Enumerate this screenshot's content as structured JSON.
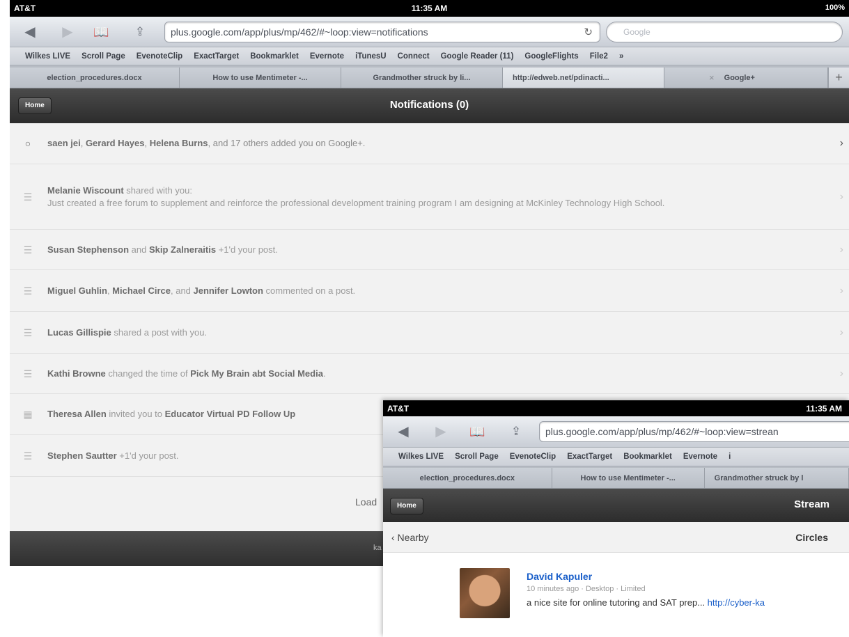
{
  "main": {
    "status": {
      "carrier": "AT&T",
      "time": "11:35 AM",
      "battery": "100%"
    },
    "url": "plus.google.com/app/plus/mp/462/#~loop:view=notifications",
    "search_placeholder": "Google",
    "bookmarks": [
      "Wilkes LIVE",
      "Scroll Page",
      "EvenoteClip",
      "ExactTarget",
      "Bookmarklet",
      "Evernote",
      "iTunesU",
      "Connect",
      "Google Reader (11)",
      "GoogleFlights",
      "File2",
      "»"
    ],
    "tabs": [
      {
        "label": "election_procedures.docx"
      },
      {
        "label": "How to use Mentimeter -..."
      },
      {
        "label": "Grandmother struck by li..."
      },
      {
        "label": "http://edweb.net/pdinacti..."
      },
      {
        "label": "Google+"
      }
    ],
    "tab_close": "×",
    "tab_plus": "+",
    "home_label": "Home",
    "title": "Notifications (0)",
    "notifications": [
      {
        "bold1": "saen jei",
        "t1": ", ",
        "bold2": "Gerard Hayes",
        "t2": ", ",
        "bold3": "Helena Burns",
        "t3": ", and 17 others added you on Google+."
      },
      {
        "bold1": "Melanie Wiscount",
        "t1": " shared with you:",
        "line2": "Just created a free forum to supplement and reinforce the professional development training program I am designing at McKinley Technology High School."
      },
      {
        "bold1": "Susan Stephenson",
        "t1": " and ",
        "bold2": "Skip Zalneraitis",
        "t2": " +1'd your post."
      },
      {
        "bold1": "Miguel Guhlin",
        "t1": ", ",
        "bold2": "Michael Circe",
        "t2": ", and ",
        "bold3": "Jennifer Lowton",
        "t3": " commented on a post."
      },
      {
        "bold1": "Lucas Gillispie",
        "t1": " shared a post with you."
      },
      {
        "bold1": "Kathi Browne",
        "t1": " changed the time of ",
        "bold2": "Pick My Brain abt Social Media",
        "t2": "."
      },
      {
        "bold1": "Theresa Allen",
        "t1": " invited you to ",
        "bold2": "Educator Virtual PD Follow Up",
        "t2": ""
      },
      {
        "bold1": "Stephen Sautter",
        "t1": " +1'd your post."
      }
    ],
    "load_text": "Load",
    "footer_text": "ka"
  },
  "overlay": {
    "status": {
      "carrier": "AT&T",
      "time": "11:35 AM"
    },
    "url": "plus.google.com/app/plus/mp/462/#~loop:view=strean",
    "bookmarks": [
      "Wilkes LIVE",
      "Scroll Page",
      "EvenoteClip",
      "ExactTarget",
      "Bookmarklet",
      "Evernote",
      "i"
    ],
    "tabs": [
      {
        "label": "election_procedures.docx"
      },
      {
        "label": "How to use Mentimeter -..."
      },
      {
        "label": "Grandmother struck by l"
      }
    ],
    "home_label": "Home",
    "title": "Stream",
    "nearby": "‹ Nearby",
    "circles": "Circles",
    "post": {
      "author": "David Kapuler",
      "meta": "10 minutes ago · Desktop · Limited",
      "body": "a nice site for online tutoring and SAT prep... ",
      "link": "http://cyber-ka"
    }
  }
}
